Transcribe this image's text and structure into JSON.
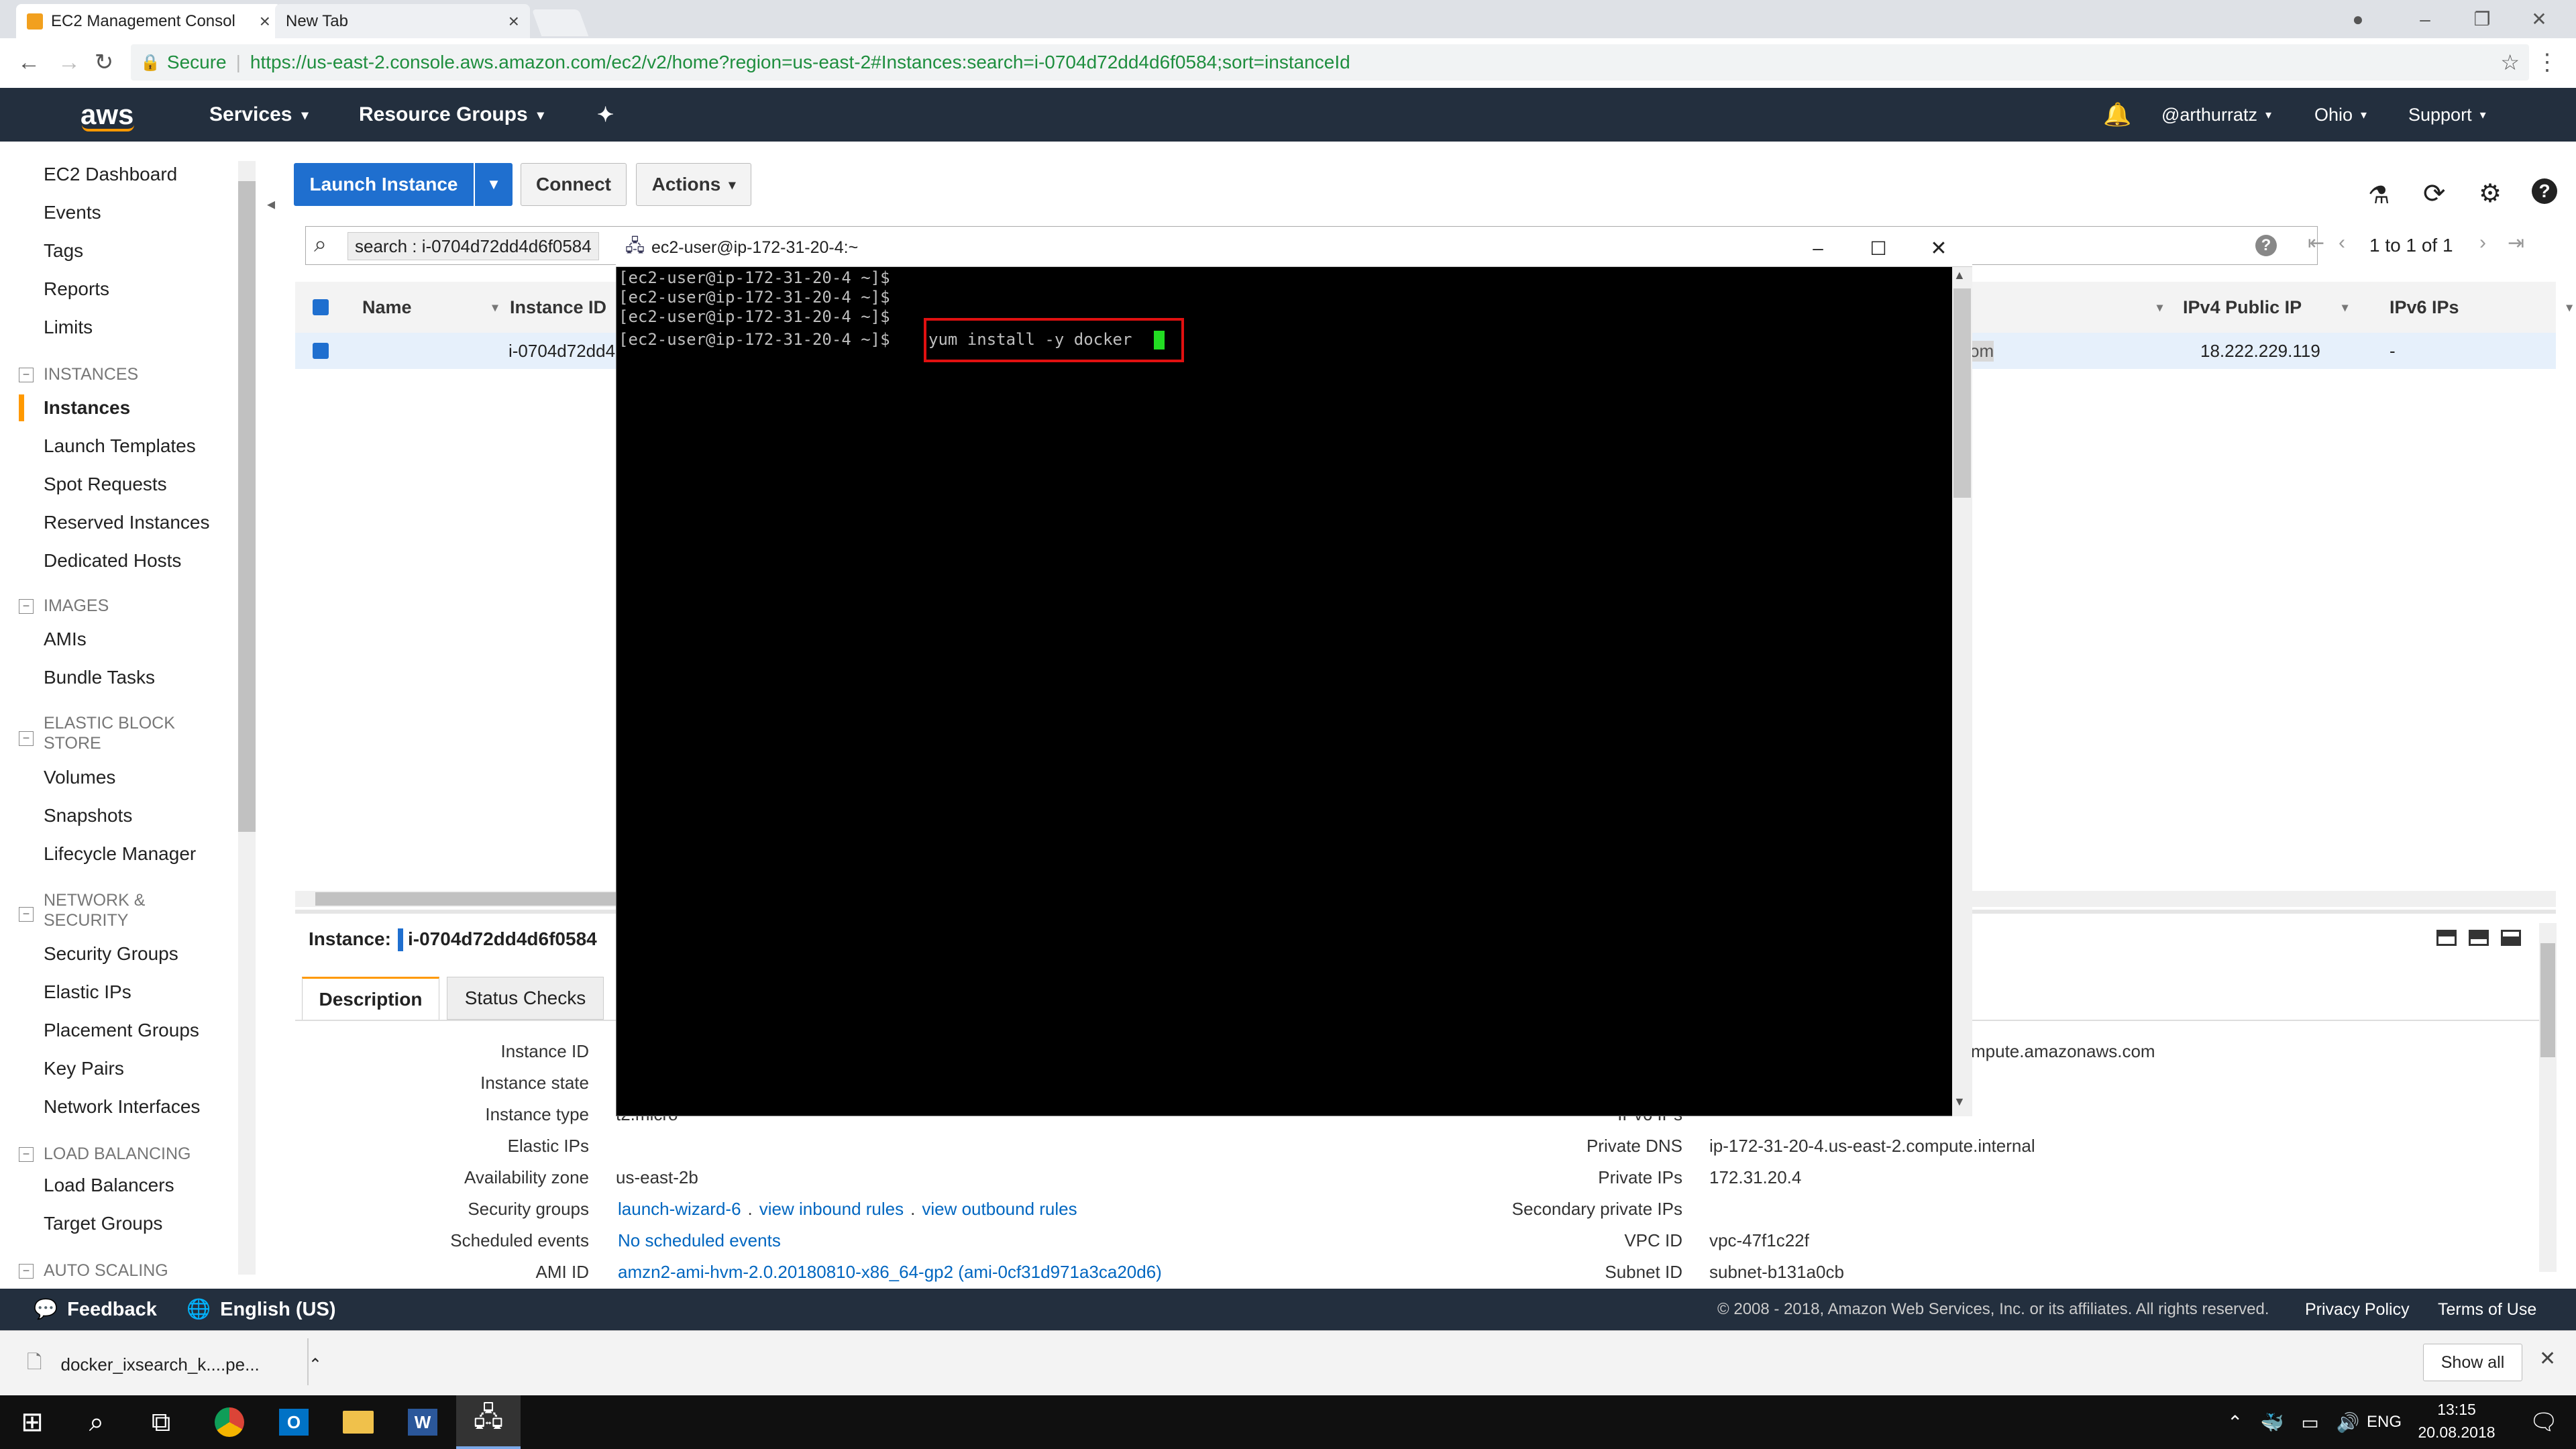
{
  "browser": {
    "tabs": [
      {
        "label": "EC2 Management Consol",
        "active": true
      },
      {
        "label": "New Tab",
        "active": false
      }
    ],
    "secure_label": "Secure",
    "url": "https://us-east-2.console.aws.amazon.com/ec2/v2/home?region=us-east-2#Instances:search=i-0704d72dd4d6f0584;sort=instanceId"
  },
  "awsnav": {
    "logo": "aws",
    "services": "Services",
    "resource_groups": "Resource Groups",
    "user": "@arthurratz",
    "region": "Ohio",
    "support": "Support"
  },
  "sidebar": {
    "top_items": [
      "EC2 Dashboard",
      "Events",
      "Tags",
      "Reports",
      "Limits"
    ],
    "sections": [
      {
        "heading": "INSTANCES",
        "items": [
          "Instances",
          "Launch Templates",
          "Spot Requests",
          "Reserved Instances",
          "Dedicated Hosts"
        ]
      },
      {
        "heading": "IMAGES",
        "items": [
          "AMIs",
          "Bundle Tasks"
        ]
      },
      {
        "heading": "ELASTIC BLOCK STORE",
        "items": [
          "Volumes",
          "Snapshots",
          "Lifecycle Manager"
        ]
      },
      {
        "heading": "NETWORK & SECURITY",
        "items": [
          "Security Groups",
          "Elastic IPs",
          "Placement Groups",
          "Key Pairs",
          "Network Interfaces"
        ]
      },
      {
        "heading": "LOAD BALANCING",
        "items": [
          "Load Balancers",
          "Target Groups"
        ]
      },
      {
        "heading": "AUTO SCALING",
        "items": []
      }
    ],
    "active": "Instances"
  },
  "toolbar": {
    "launch": "Launch Instance",
    "connect": "Connect",
    "actions": "Actions"
  },
  "search": {
    "tag": "search : i-0704d72dd4d6f0584",
    "pagination": "1 to 1 of 1"
  },
  "table": {
    "columns": [
      "Name",
      "Instance ID",
      "IPv4 Public IP",
      "IPv6 IPs"
    ],
    "row": {
      "instance_id": "i-0704d72dd4",
      "dns_suffix": "om",
      "ipv4": "18.222.229.119",
      "ipv6": "-"
    }
  },
  "details": {
    "instance_label": "Instance:",
    "instance_id": "i-0704d72dd4d6f0584",
    "tabs": [
      "Description",
      "Status Checks"
    ],
    "labels": [
      "Instance ID",
      "Instance state",
      "Instance type",
      "Elastic IPs",
      "Availability zone",
      "Security groups",
      "Scheduled events",
      "AMI ID"
    ],
    "availability_zone": "us-east-2b",
    "instance_type_partial": "t2.micro",
    "security_group": "launch-wizard-6",
    "view_inbound": "view inbound rules",
    "view_outbound": "view outbound rules",
    "scheduled_events": "No scheduled events",
    "ami_id": "amzn2-ami-hvm-2.0.20180810-x86_64-gp2 (ami-0cf31d971a3ca20d6)",
    "public_dns_partial": "mpute.amazonaws.com",
    "right_labels": [
      "IPv6 IPs",
      "Private DNS",
      "Private IPs",
      "Secondary private IPs",
      "VPC ID",
      "Subnet ID"
    ],
    "private_dns": "ip-172-31-20-4.us-east-2.compute.internal",
    "private_ips": "172.31.20.4",
    "vpc_id": "vpc-47f1c22f",
    "subnet_id": "subnet-b131a0cb"
  },
  "terminal": {
    "title": "ec2-user@ip-172-31-20-4:~",
    "lines": [
      "[ec2-user@ip-172-31-20-4 ~]$",
      "[ec2-user@ip-172-31-20-4 ~]$",
      "[ec2-user@ip-172-31-20-4 ~]$",
      "[ec2-user@ip-172-31-20-4 ~]$"
    ],
    "command": "yum install -y docker"
  },
  "footer": {
    "feedback": "Feedback",
    "language": "English (US)",
    "copyright": "© 2008 - 2018, Amazon Web Services, Inc. or its affiliates. All rights reserved.",
    "privacy": "Privacy Policy",
    "terms": "Terms of Use"
  },
  "downloads": {
    "file": "docker_ixsearch_k....pe...",
    "show_all": "Show all"
  },
  "taskbar": {
    "lang": "ENG",
    "time": "13:15",
    "date": "20.08.2018"
  }
}
